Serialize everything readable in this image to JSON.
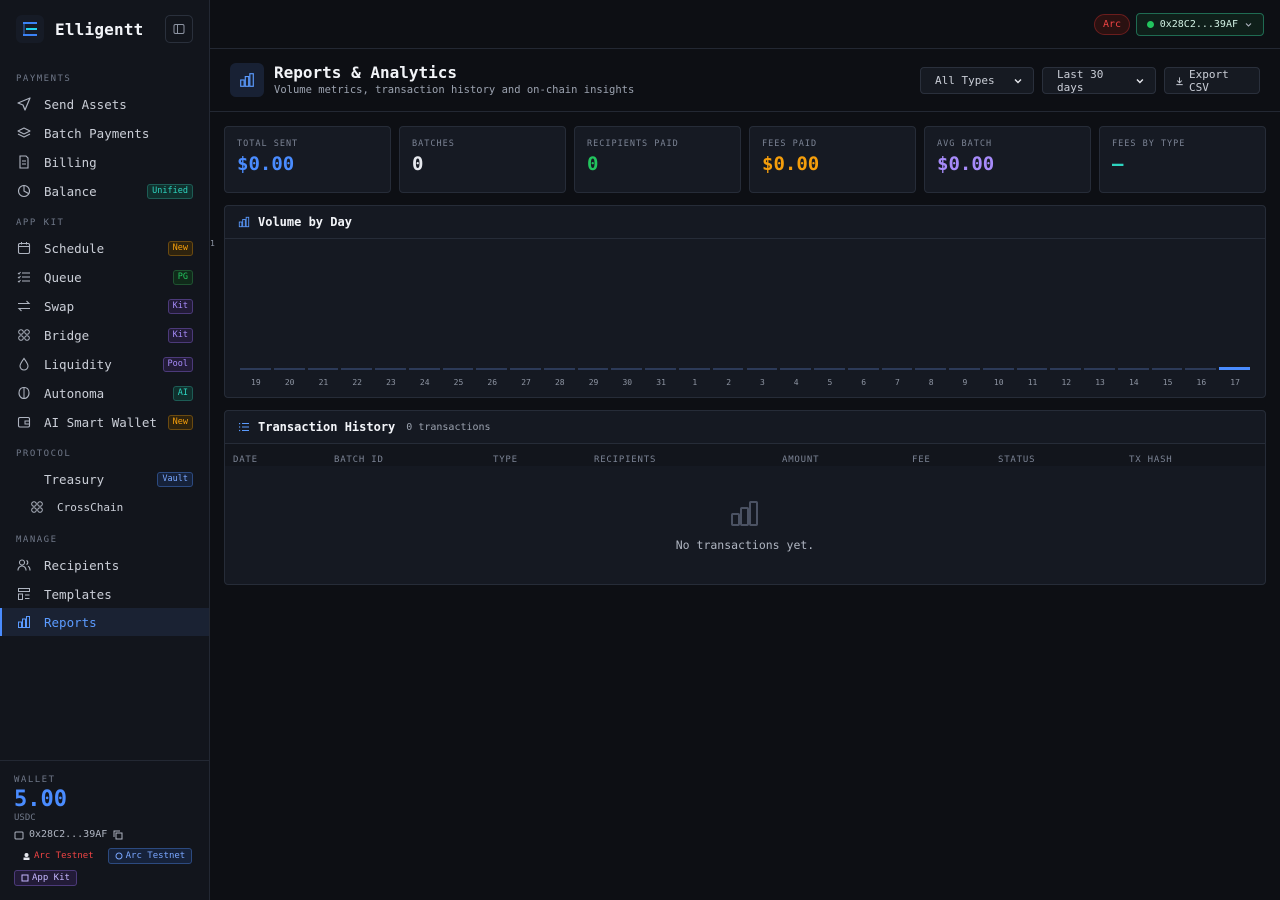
{
  "app": {
    "name": "Elligentt"
  },
  "sidebar": {
    "sections": {
      "payments": "PAYMENTS",
      "app_kit": "APP KIT",
      "protocol": "PROTOCOL",
      "manage": "MANAGE"
    },
    "items": [
      {
        "label": "Send Assets",
        "icon": "send-icon"
      },
      {
        "label": "Batch Payments",
        "icon": "layers-icon"
      },
      {
        "label": "Billing",
        "icon": "document-icon"
      },
      {
        "label": "Balance",
        "icon": "pie-icon",
        "badge": "Unified"
      },
      {
        "label": "Schedule",
        "icon": "calendar-icon",
        "badge": "New"
      },
      {
        "label": "Queue",
        "icon": "list-check-icon",
        "badge": "PG"
      },
      {
        "label": "Swap",
        "icon": "swap-icon",
        "badge": "Kit"
      },
      {
        "label": "Bridge",
        "icon": "bridge-icon",
        "badge": "Kit"
      },
      {
        "label": "Liquidity",
        "icon": "droplet-icon",
        "badge": "Pool"
      },
      {
        "label": "Autonoma",
        "icon": "bot-icon",
        "badge": "AI"
      },
      {
        "label": "AI Smart Wallet",
        "icon": "wallet-icon",
        "badge": "New"
      },
      {
        "label": "Treasury",
        "badge": "Vault"
      },
      {
        "label": "CrossChain",
        "icon": "crosschain-icon"
      },
      {
        "label": "Recipients",
        "icon": "users-icon"
      },
      {
        "label": "Templates",
        "icon": "template-icon"
      },
      {
        "label": "Reports",
        "icon": "chart-icon"
      }
    ],
    "wallet": {
      "label": "WALLET",
      "amount": "5.00",
      "unit": "USDC",
      "address": "0x28C2...39AF",
      "chips": [
        "Arc Testnet",
        "Arc Testnet",
        "App Kit"
      ]
    }
  },
  "topbar": {
    "network": "Arc",
    "address": "0x28C2...39AF"
  },
  "page": {
    "title": "Reports & Analytics",
    "subtitle": "Volume metrics, transaction history and on-chain insights",
    "filter_type": "All Types",
    "filter_range": "Last 30 days",
    "export": "Export CSV"
  },
  "stats": [
    {
      "label": "TOTAL SENT",
      "value": "$0.00",
      "color": "#4a8cff"
    },
    {
      "label": "BATCHES",
      "value": "0",
      "color": "#e6e8ee"
    },
    {
      "label": "RECIPIENTS PAID",
      "value": "0",
      "color": "#22c55e"
    },
    {
      "label": "FEES PAID",
      "value": "$0.00",
      "color": "#f59e0b"
    },
    {
      "label": "AVG BATCH",
      "value": "$0.00",
      "color": "#a78bfa"
    },
    {
      "label": "FEES BY TYPE",
      "value": "—",
      "color": "#2dd4bf"
    }
  ],
  "chart_data": {
    "type": "bar",
    "title": "Volume by Day",
    "ymax_label": "1",
    "categories": [
      "19",
      "20",
      "21",
      "22",
      "23",
      "24",
      "25",
      "26",
      "27",
      "28",
      "29",
      "30",
      "31",
      "1",
      "2",
      "3",
      "4",
      "5",
      "6",
      "7",
      "8",
      "9",
      "10",
      "11",
      "12",
      "13",
      "14",
      "15",
      "16",
      "17"
    ],
    "values": [
      0,
      0,
      0,
      0,
      0,
      0,
      0,
      0,
      0,
      0,
      0,
      0,
      0,
      0,
      0,
      0,
      0,
      0,
      0,
      0,
      0,
      0,
      0,
      0,
      0,
      0,
      0,
      0,
      0,
      0
    ],
    "highlight_last": true
  },
  "history": {
    "title": "Transaction History",
    "count": "0 transactions",
    "columns": [
      "DATE",
      "BATCH ID",
      "TYPE",
      "RECIPIENTS",
      "AMOUNT",
      "FEE",
      "STATUS",
      "TX HASH"
    ],
    "empty": "No transactions yet."
  }
}
